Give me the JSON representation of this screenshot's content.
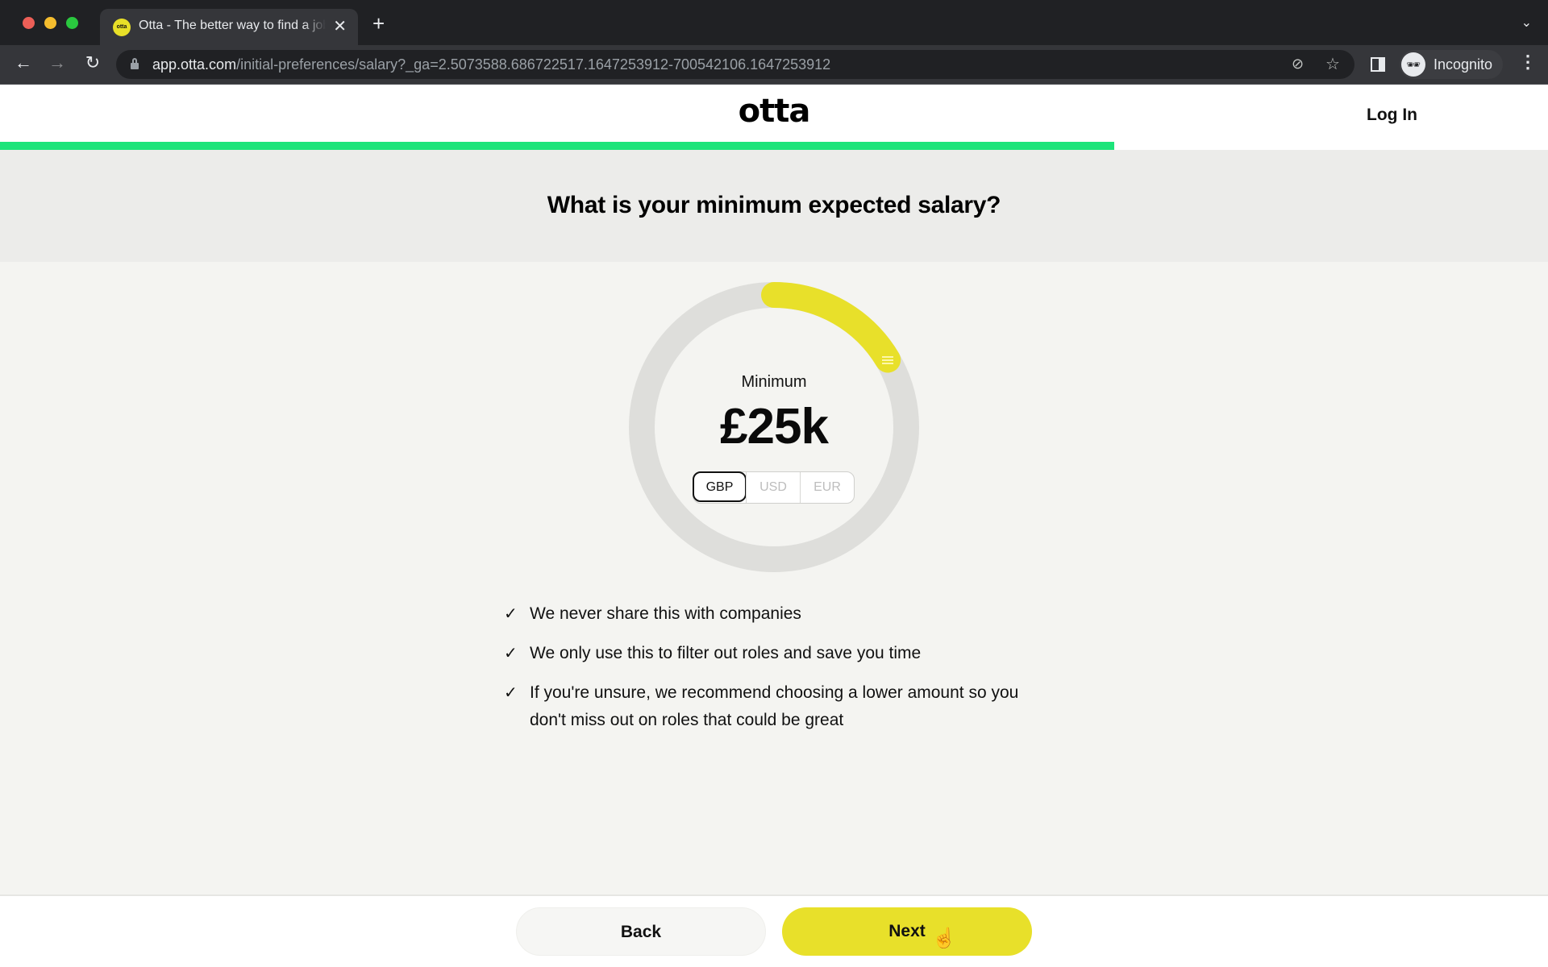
{
  "browser": {
    "tab_title": "Otta - The better way to find a job",
    "favicon_text": "otta",
    "url_host": "app.otta.com",
    "url_path": "/initial-preferences/salary?_ga=2.5073588.686722517.1647253912-700542106.1647253912",
    "profile_label": "Incognito",
    "icons": {
      "back": "←",
      "forward": "→",
      "reload": "↻",
      "close": "✕",
      "new_tab": "+",
      "tab_list": "⌄",
      "eye_off": "⊘",
      "star": "☆",
      "incognito": "🕶",
      "menu": "⋮"
    }
  },
  "header": {
    "logo": "otta",
    "login_label": "Log In",
    "progress_fraction": 0.72,
    "progress_color": "#1de47a"
  },
  "question": {
    "title": "What is your minimum expected salary?"
  },
  "salary_dial": {
    "label": "Minimum",
    "value_display": "£25k",
    "fill_fraction": 0.165,
    "fill_color": "#e8e02a",
    "track_color": "#dededb",
    "currencies": [
      {
        "code": "GBP",
        "selected": true
      },
      {
        "code": "USD",
        "selected": false
      },
      {
        "code": "EUR",
        "selected": false
      }
    ]
  },
  "reassurances": [
    {
      "icon": "✓",
      "text": "We never share this with companies"
    },
    {
      "icon": "✓",
      "text": "We only use this to filter out roles and save you time"
    },
    {
      "icon": "✓",
      "text": "If you're unsure, we recommend choosing a lower amount so you don't miss out on roles that could be great"
    }
  ],
  "footer": {
    "back_label": "Back",
    "next_label": "Next",
    "next_color": "#e8e02a"
  }
}
